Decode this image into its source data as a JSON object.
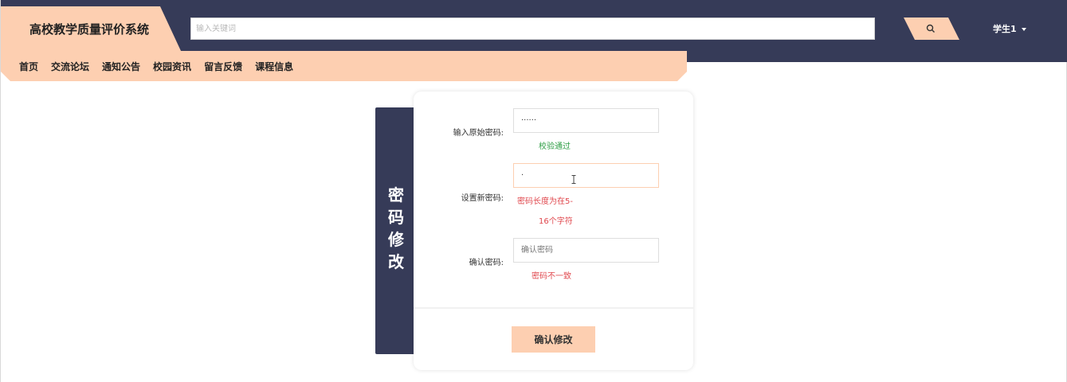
{
  "header": {
    "brand_title": "高校教学质量评价系统",
    "search_placeholder": "输入关键词",
    "user_label": "学生1"
  },
  "nav": {
    "items": [
      "首页",
      "交流论坛",
      "通知公告",
      "校园资讯",
      "留言反馈",
      "课程信息"
    ]
  },
  "panel": {
    "side_title": "密码修改"
  },
  "form": {
    "old_password": {
      "label": "输入原始密码:",
      "value": "······",
      "message": "校验通过"
    },
    "new_password": {
      "label": "设置新密码:",
      "value": "·",
      "message_line1": "密码长度为在5-",
      "message_line2": "16个字符"
    },
    "confirm_password": {
      "label": "确认密码:",
      "placeholder": "确认密码",
      "message": "密码不一致"
    },
    "submit_label": "确认修改"
  },
  "colors": {
    "navy": "#363b58",
    "peach": "#fdcfb1",
    "success": "#2e9e45",
    "error": "#e0484e"
  }
}
